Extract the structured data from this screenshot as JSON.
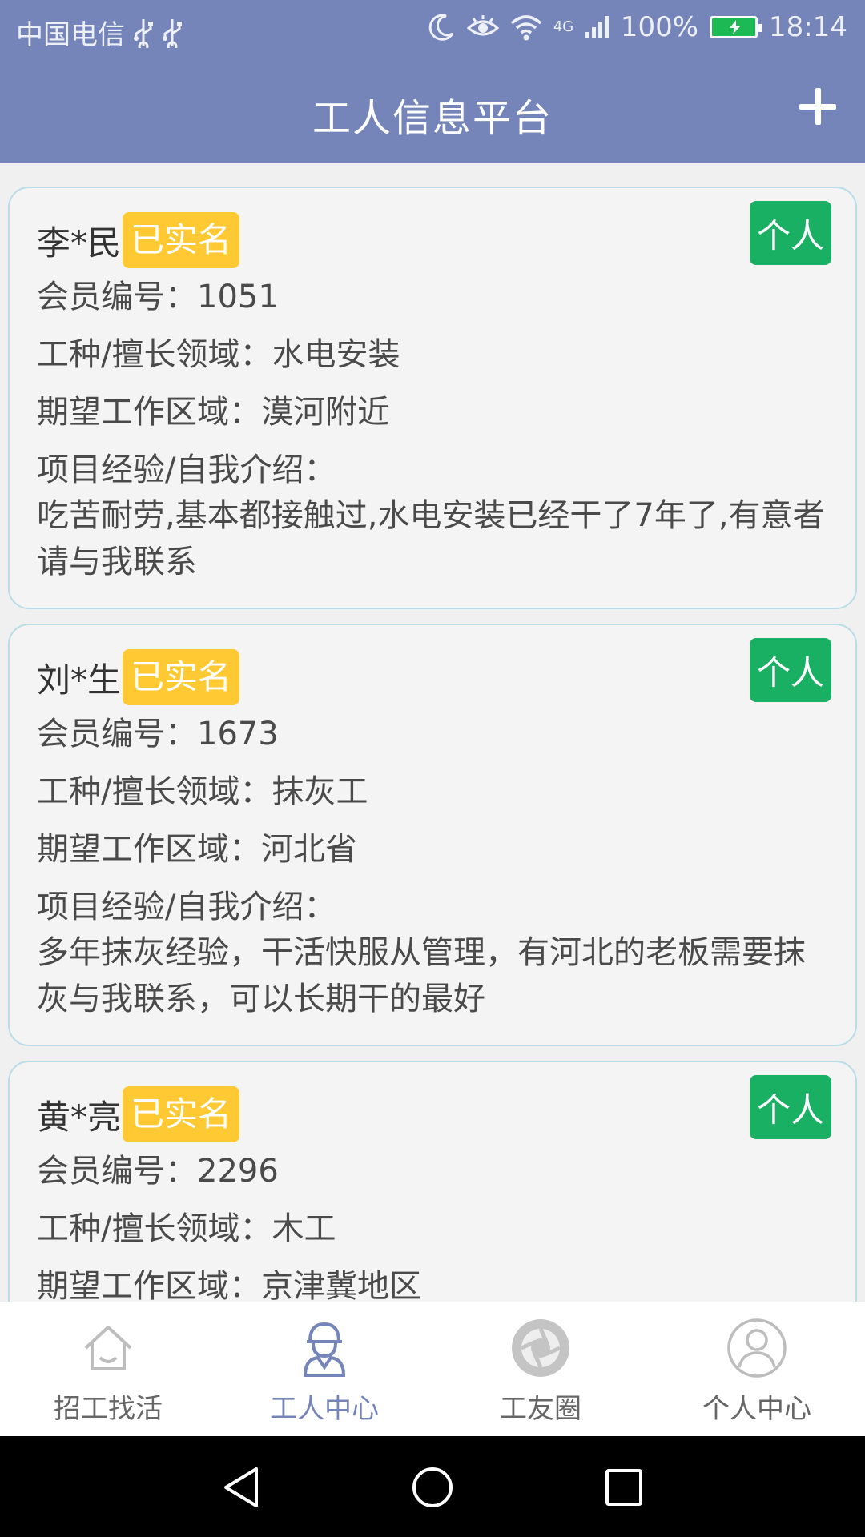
{
  "status_bar": {
    "carrier": "中国电信",
    "network": "4G",
    "battery": "100%",
    "time": "18:14"
  },
  "header": {
    "title": "工人信息平台"
  },
  "workers": [
    {
      "name": "李*民",
      "verified": "已实名",
      "type": "个人",
      "member_id": "会员编号：1051",
      "skill": "工种/擅长领域：水电安装",
      "area": "期望工作区域：漠河附近",
      "intro_label": "项目经验/自我介绍：",
      "intro": "吃苦耐劳,基本都接触过,水电安装已经干了7年了,有意者请与我联系"
    },
    {
      "name": "刘*生",
      "verified": "已实名",
      "type": "个人",
      "member_id": "会员编号：1673",
      "skill": "工种/擅长领域：抹灰工",
      "area": "期望工作区域：河北省",
      "intro_label": "项目经验/自我介绍：",
      "intro": "多年抹灰经验，干活快服从管理，有河北的老板需要抹灰与我联系，可以长期干的最好"
    },
    {
      "name": "黄*亮",
      "verified": "已实名",
      "type": "个人",
      "member_id": "会员编号：2296",
      "skill": "工种/擅长领域：木工",
      "area": "期望工作区域：京津冀地区"
    }
  ],
  "bottom_nav": [
    {
      "label": "招工找活",
      "icon": "house-icon"
    },
    {
      "label": "工人中心",
      "icon": "worker-icon",
      "active": true
    },
    {
      "label": "工友圈",
      "icon": "camera-aperture-icon"
    },
    {
      "label": "个人中心",
      "icon": "user-profile-icon"
    }
  ],
  "colors": {
    "header": "#7585b9",
    "verified_badge": "#ffc933",
    "type_badge": "#19b064",
    "card_border": "#b9dce7"
  }
}
